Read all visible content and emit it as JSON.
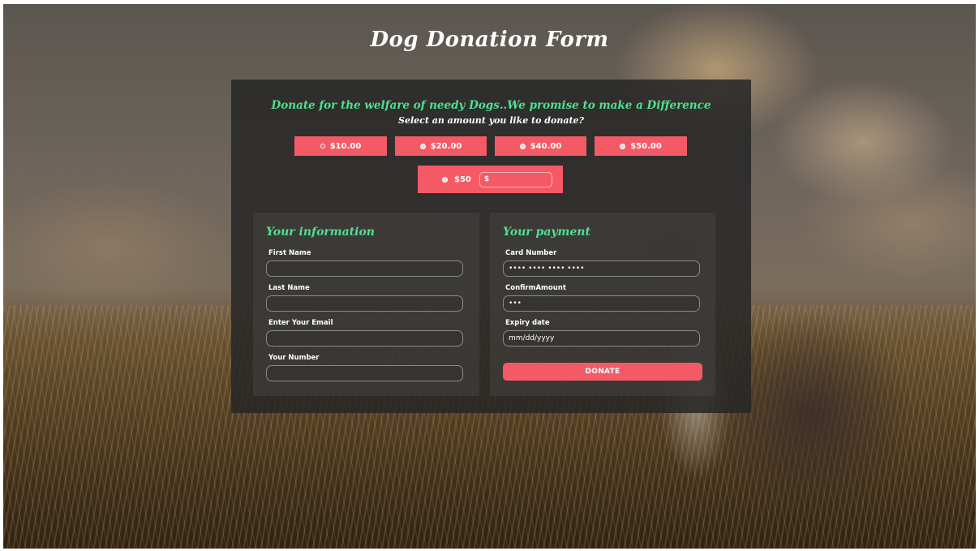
{
  "page": {
    "title": "Dog Donation Form"
  },
  "intro": {
    "tagline": "Donate for the welfare of needy Dogs..We promise to make a Difference",
    "question": "Select an amount you like to donate?"
  },
  "amounts": {
    "options": [
      "$10.00",
      "$20.00",
      "$40.00",
      "$50.00"
    ],
    "selected_index": 0,
    "custom_label": "$50",
    "custom_value": "$"
  },
  "info": {
    "heading": "Your information",
    "first_name_label": "First Name",
    "last_name_label": "Last Name",
    "email_label": "Enter Your Email",
    "number_label": "Your Number"
  },
  "payment": {
    "heading": "Your payment",
    "card_label": "Card Number",
    "card_value": "•••• •••• •••• ••••",
    "confirm_label": "ConfirmAmount",
    "confirm_value": "•••",
    "expiry_label": "Expiry date",
    "expiry_value": "mm/dd/yyyy",
    "donate_label": "DONATE"
  },
  "colors": {
    "accent": "#f45a66",
    "heading_green": "#4fe08f",
    "panel": "#262626"
  }
}
